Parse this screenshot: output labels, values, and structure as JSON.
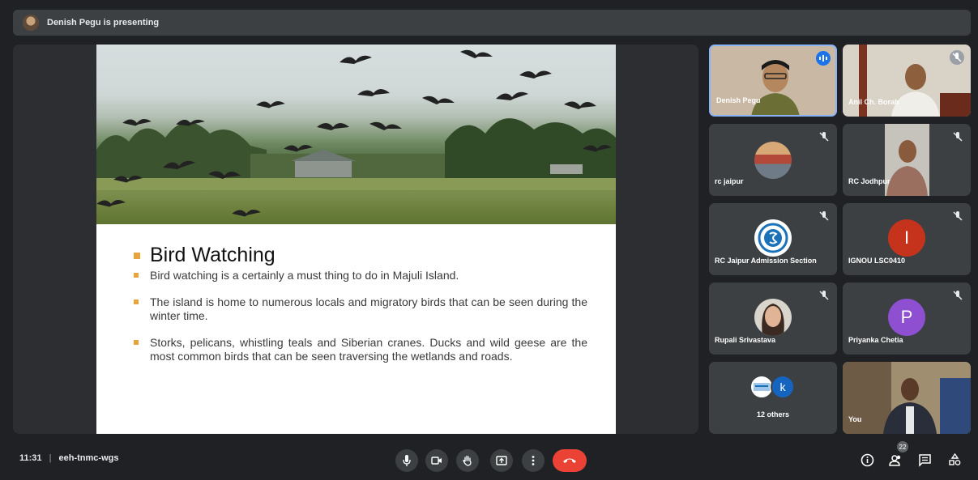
{
  "presenter_bar": {
    "text": "Denish Pegu is presenting"
  },
  "slide": {
    "heading": "Bird Watching",
    "bullets": [
      "Bird watching is a certainly a must thing to do in Majuli Island.",
      "The island is home to numerous locals and migratory birds that can be seen during the winter time.",
      "Storks, pelicans, whistling teals and Siberian cranes. Ducks and wild geese are the most common birds that can be seen traversing the wetlands and roads."
    ]
  },
  "participants": [
    {
      "name": "Denish Pegu",
      "state": "speaking"
    },
    {
      "name": "Anil Ch. Borah",
      "state": "muted"
    },
    {
      "name": "rc jaipur",
      "state": "muted"
    },
    {
      "name": "RC Jodhpur",
      "state": "muted"
    },
    {
      "name": "RC Jaipur Admission Section",
      "state": "muted"
    },
    {
      "name": "IGNOU LSC0410",
      "state": "muted",
      "initial": "I",
      "color": "#c5331d"
    },
    {
      "name": "Rupali Srivastava",
      "state": "muted"
    },
    {
      "name": "Priyanka Chetia",
      "state": "muted",
      "initial": "P",
      "color": "#8e4fd1"
    },
    {
      "name": "12 others",
      "initial": "k",
      "color": "#1565c0"
    },
    {
      "name": "You"
    }
  ],
  "bottom_bar": {
    "time": "11:31",
    "separator": "|",
    "meeting_code": "eeh-tnmc-wgs",
    "people_count": "22"
  },
  "icons": [
    "mic-icon",
    "camera-icon",
    "raise-hand-icon",
    "present-icon",
    "more-options-icon",
    "end-call-icon",
    "info-icon",
    "people-icon",
    "chat-icon",
    "activities-icon"
  ],
  "colors": {
    "background": "#202124",
    "tile": "#3c4043",
    "end_call": "#ea4335",
    "accent": "#8ab4f8",
    "bullet": "#e8a33a"
  }
}
